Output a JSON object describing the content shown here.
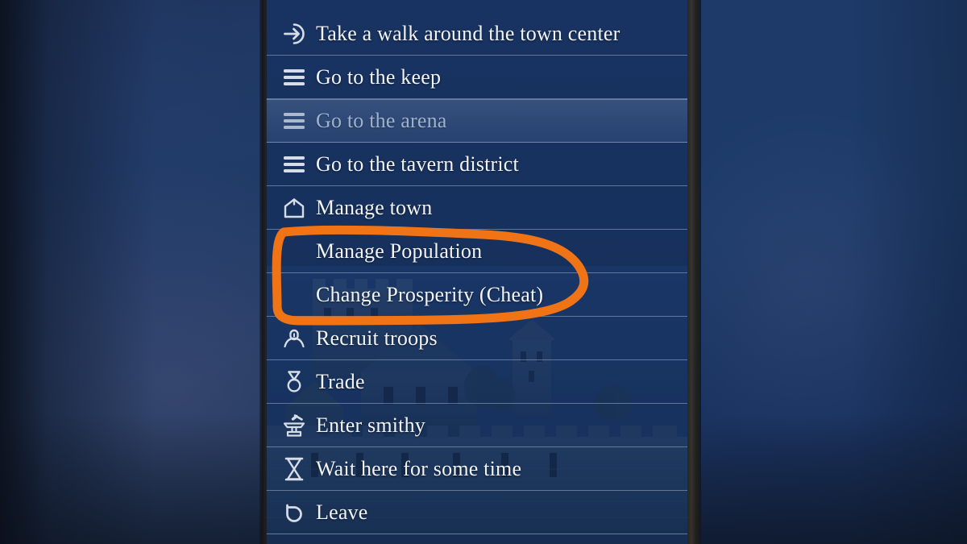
{
  "panel": {
    "name": "town-action-menu",
    "items": [
      {
        "icon": "enter-arrow-icon",
        "label": "Take a walk around the town center",
        "state": "normal",
        "sub": false
      },
      {
        "icon": "list-lines-icon",
        "label": "Go to the keep",
        "state": "normal",
        "sub": false
      },
      {
        "icon": "list-lines-icon",
        "label": "Go to the arena",
        "state": "disabled",
        "sub": false
      },
      {
        "icon": "list-lines-icon",
        "label": "Go to the tavern district",
        "state": "normal",
        "sub": false
      },
      {
        "icon": "house-icon",
        "label": "Manage town",
        "state": "normal",
        "sub": false
      },
      {
        "icon": "none",
        "label": "Manage Population",
        "state": "normal",
        "sub": true
      },
      {
        "icon": "none",
        "label": "Change Prosperity (Cheat)",
        "state": "normal",
        "sub": true
      },
      {
        "icon": "person-icon",
        "label": "Recruit troops",
        "state": "normal",
        "sub": false
      },
      {
        "icon": "denar-coin-icon",
        "label": "Trade",
        "state": "normal",
        "sub": false
      },
      {
        "icon": "anvil-icon",
        "label": "Enter smithy",
        "state": "normal",
        "sub": false
      },
      {
        "icon": "hourglass-icon",
        "label": "Wait here for some time",
        "state": "normal",
        "sub": false
      },
      {
        "icon": "back-arrow-icon",
        "label": "Leave",
        "state": "normal",
        "sub": false
      }
    ]
  },
  "annotation": {
    "name": "orange-highlight-circle",
    "color": "#f07415",
    "encircles": [
      "Manage Population",
      "Change Prosperity (Cheat)"
    ]
  },
  "colors": {
    "panel_bg": "#17315e",
    "divider": "#c4d4ec",
    "text": "#f2f4f8",
    "text_disabled": "#9fb2cc",
    "highlight_row": "#7e98c4",
    "backdrop": "#1d3a66",
    "annotation_orange": "#f07415"
  }
}
